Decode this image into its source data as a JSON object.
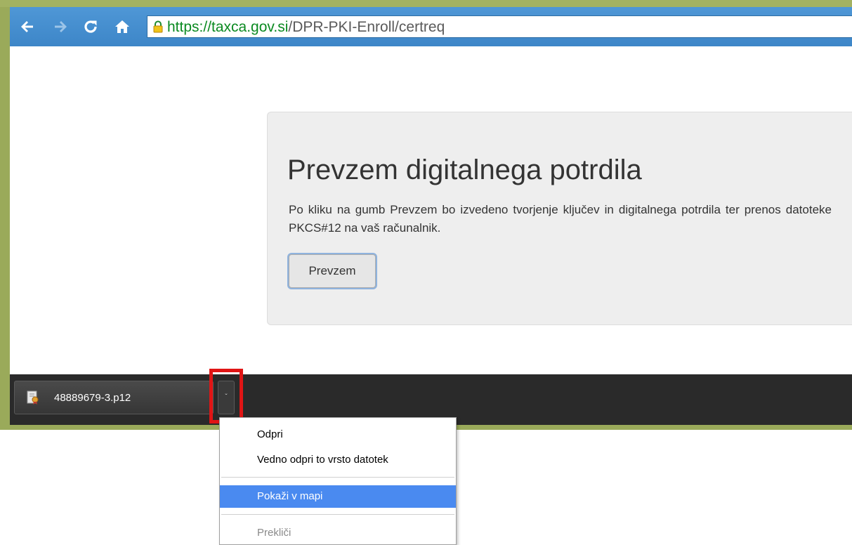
{
  "browser": {
    "url_scheme": "https://",
    "url_host": "taxca.gov.si",
    "url_path": "/DPR-PKI-Enroll/certreq",
    "icons": [
      "back-arrow-icon",
      "forward-arrow-icon",
      "reload-icon",
      "home-icon",
      "lock-icon"
    ]
  },
  "page": {
    "heading": "Prevzem digitalnega potrdila",
    "description": "Po kliku na gumb Prevzem bo izvedeno tvorjenje ključev in digitalnega potrdila ter prenos datoteke PKCS#12 na vaš računalnik.",
    "button_label": "Prevzem"
  },
  "downloads": {
    "file_name": "48889679-3.p12",
    "chevron": "ˇ"
  },
  "context_menu": {
    "items": [
      {
        "label": "Odpri",
        "state": "normal"
      },
      {
        "label": "Vedno odpri to vrsto datotek",
        "state": "normal"
      },
      {
        "label": "Pokaži v mapi",
        "state": "selected"
      },
      {
        "label": "Prekliči",
        "state": "disabled"
      }
    ]
  },
  "colors": {
    "toolbar": "#3d86c8",
    "menu_selected": "#4a8af0",
    "highlight": "#e01515",
    "shelf": "#2a2a2a"
  }
}
